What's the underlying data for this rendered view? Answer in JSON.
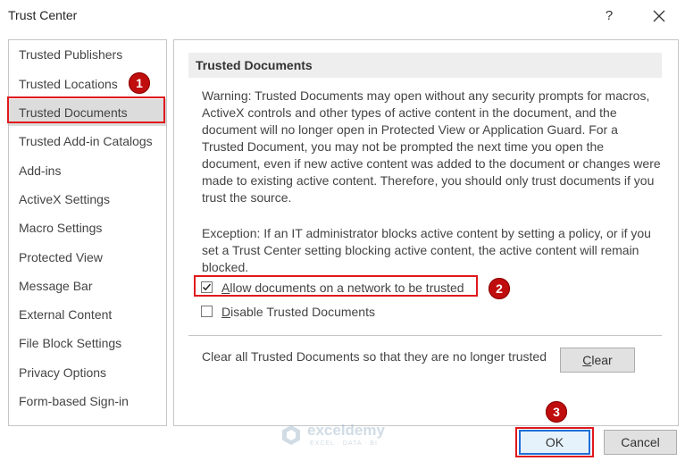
{
  "window": {
    "title": "Trust Center",
    "help_label": "?"
  },
  "sidebar": {
    "items": [
      {
        "label": "Trusted Publishers"
      },
      {
        "label": "Trusted Locations"
      },
      {
        "label": "Trusted Documents",
        "selected": true
      },
      {
        "label": "Trusted Add-in Catalogs"
      },
      {
        "label": "Add-ins"
      },
      {
        "label": "ActiveX Settings"
      },
      {
        "label": "Macro Settings"
      },
      {
        "label": "Protected View"
      },
      {
        "label": "Message Bar"
      },
      {
        "label": "External Content"
      },
      {
        "label": "File Block Settings"
      },
      {
        "label": "Privacy Options"
      },
      {
        "label": "Form-based Sign-in"
      }
    ]
  },
  "main": {
    "section_title": "Trusted Documents",
    "warning_text": "Warning: Trusted Documents may open without any security prompts for macros, ActiveX controls and other types of active content in the document, and the document will no longer open in Protected View or Application Guard. For a Trusted Document, you may not be prompted the next time you open the document, even if new active content was added to the document or changes were made to existing active content. Therefore, you should only trust documents if you trust the source.",
    "exception_text": "Exception: If an IT administrator blocks active content by setting a policy, or if you set a Trust Center setting blocking active content, the active content will remain blocked.",
    "allow_network": {
      "label_ul": "A",
      "label_rest": "llow documents on a network to be trusted",
      "checked": true
    },
    "disable_trusted": {
      "label_ul": "D",
      "label_rest": "isable Trusted Documents",
      "checked": false
    },
    "clear_text": "Clear all Trusted Documents so that they are no longer trusted",
    "clear_button": {
      "label_ul": "C",
      "label_rest": "lear"
    }
  },
  "footer": {
    "ok_label": "OK",
    "cancel_label": "Cancel"
  },
  "annotations": {
    "step1": "1",
    "step2": "2",
    "step3": "3"
  },
  "watermark": {
    "name": "exceldemy",
    "tagline": "EXCEL · DATA · BI"
  },
  "colors": {
    "highlight": "#e0181c",
    "badge": "#c00d0d",
    "ok_border": "#1f6fd6"
  }
}
